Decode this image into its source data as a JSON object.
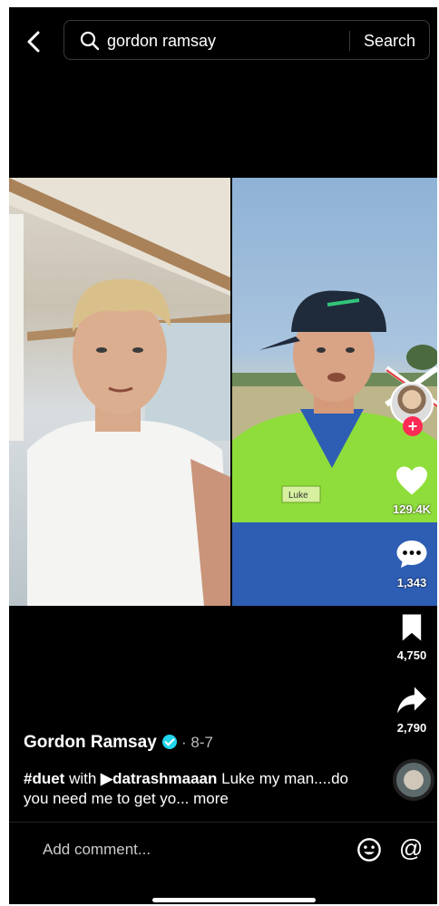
{
  "search": {
    "query": "gordon ramsay",
    "button_label": "Search"
  },
  "video": {
    "right_name_tag": "Luke"
  },
  "rail": {
    "likes": "129.4K",
    "comments": "1,343",
    "bookmarks": "4,750",
    "shares": "2,790"
  },
  "post": {
    "author": "Gordon Ramsay",
    "date": "· 8-7",
    "hashtag": "#duet",
    "with_text": "with",
    "mention": "datrashmaaan",
    "caption_rest": "Luke my man....do you need me to get yo...",
    "more_label": "more"
  },
  "comment_bar": {
    "placeholder": "Add comment..."
  },
  "colors": {
    "accent": "#fe2c55",
    "verified": "#20d5ec",
    "background": "#000000"
  },
  "icons": [
    "back-icon",
    "search-icon",
    "heart-icon",
    "comment-icon",
    "bookmark-icon",
    "share-icon",
    "emoji-icon",
    "at-icon",
    "plus-icon",
    "verified-icon"
  ]
}
